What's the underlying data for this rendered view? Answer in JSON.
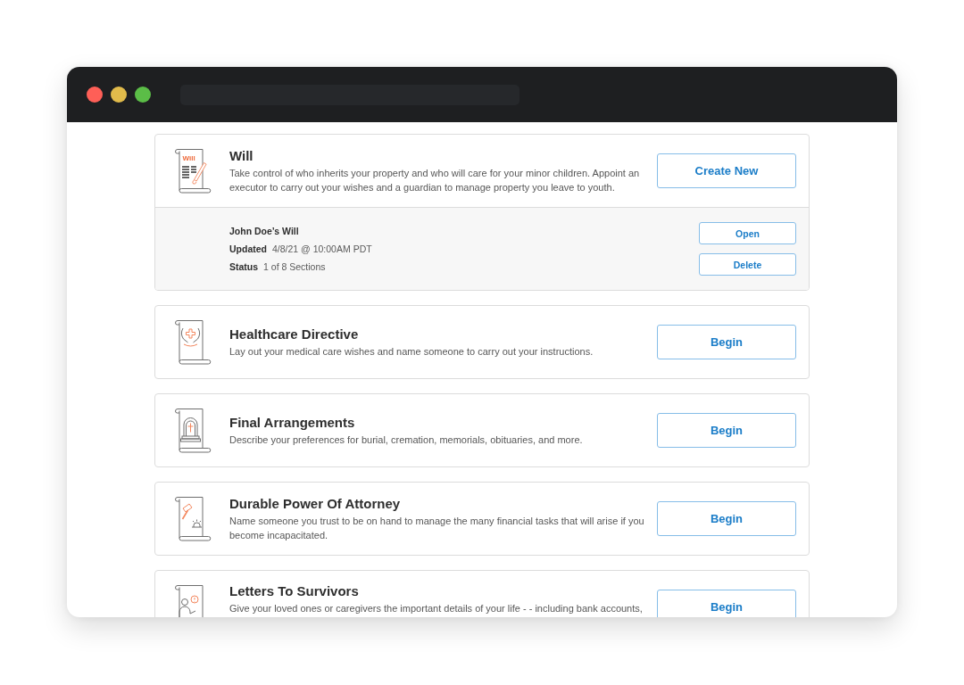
{
  "cards": [
    {
      "title": "Will",
      "icon_text": "Will",
      "description": "Take control of who inherits your property and who will care for your minor children. Appoint an executor to carry out your wishes and a guardian to manage property you leave to youth.",
      "action": "Create New",
      "documents": [
        {
          "name": "John Doe’s Will",
          "fields": [
            {
              "label": "Updated",
              "value": "4/8/21 @ 10:00AM PDT"
            },
            {
              "label": "Status",
              "value": "1 of 8 Sections"
            }
          ],
          "buttons": [
            "Open",
            "Delete"
          ]
        }
      ]
    },
    {
      "title": "Healthcare Directive",
      "description": "Lay out your medical care wishes and name someone to carry out your instructions.",
      "action": "Begin"
    },
    {
      "title": "Final Arrangements",
      "description": "Describe your preferences for burial, cremation, memorials, obituaries, and more.",
      "action": "Begin"
    },
    {
      "title": "Durable Power Of Attorney",
      "description": "Name someone you trust to be on hand to manage the many financial tasks that will arise if you become incapacitated.",
      "action": "Begin"
    },
    {
      "title": "Letters To Survivors",
      "description": "Give your loved ones or caregivers the important details of your life - - including bank accounts,",
      "action": "Begin"
    }
  ]
}
